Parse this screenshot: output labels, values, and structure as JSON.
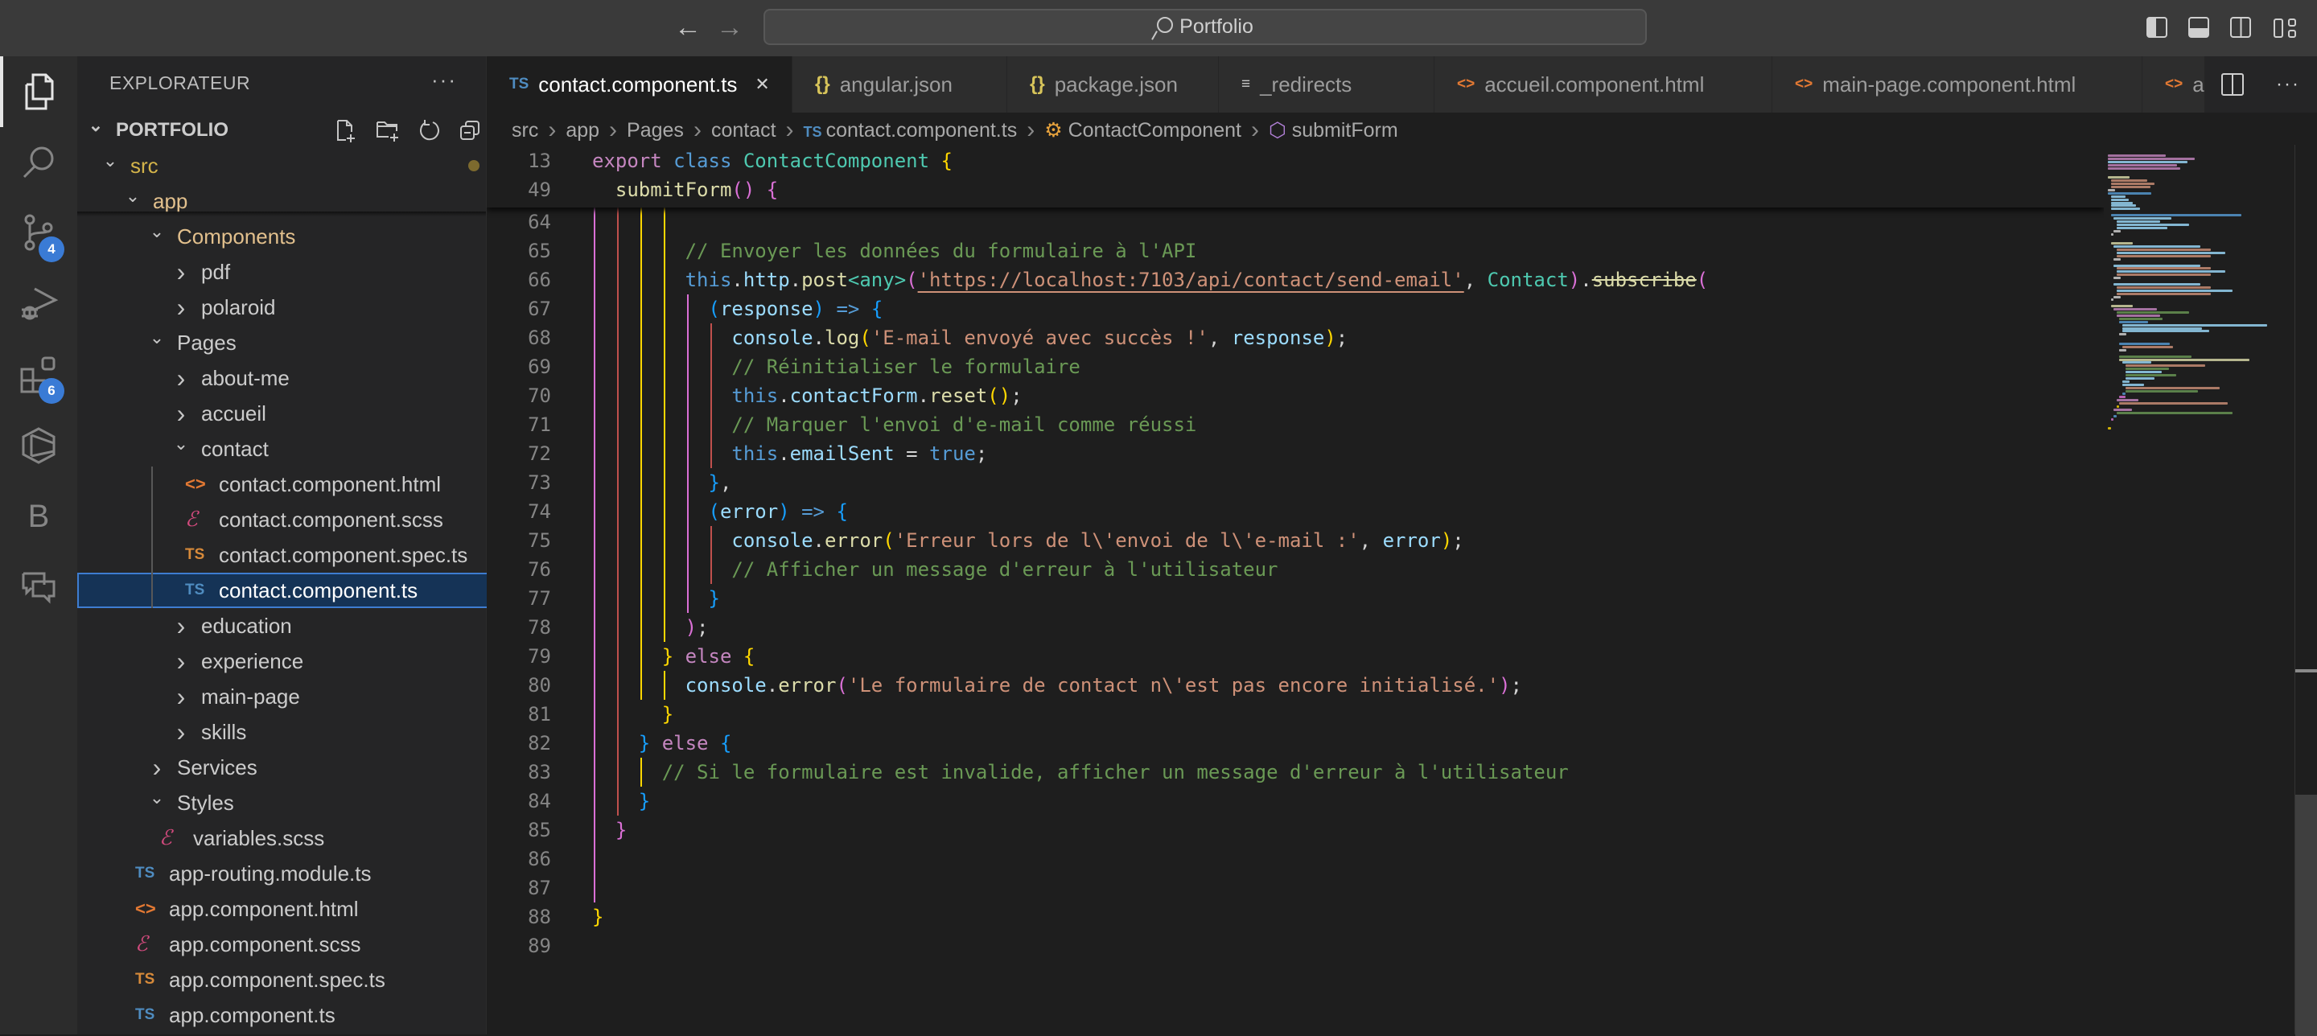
{
  "titlebar": {
    "back_icon": "arrow-left-icon",
    "forward_icon": "arrow-right-icon",
    "search_text": "Portfolio",
    "layout_toggles": [
      "toggle-primary-sidebar-icon",
      "toggle-panel-icon",
      "toggle-secondary-sidebar-icon",
      "customize-layout-icon"
    ]
  },
  "activity_bar": {
    "items": [
      {
        "name": "explorer",
        "icon": "files-icon",
        "active": true
      },
      {
        "name": "search",
        "icon": "search-icon"
      },
      {
        "name": "source-control",
        "icon": "source-control-icon",
        "badge": "4"
      },
      {
        "name": "run-debug",
        "icon": "run-debug-icon"
      },
      {
        "name": "extensions",
        "icon": "extensions-icon",
        "badge": "6"
      },
      {
        "name": "remote-explorer",
        "icon": "hexagon-icon"
      },
      {
        "name": "bootstrap",
        "icon": "b-letter-icon",
        "label": "B"
      },
      {
        "name": "chat",
        "icon": "chat-icon"
      }
    ]
  },
  "sidebar": {
    "title": "EXPLORATEUR",
    "more": "···",
    "root": "PORTFOLIO",
    "tree": [
      {
        "label": "src",
        "type": "folder",
        "open": true,
        "level": 1,
        "git": "modified"
      },
      {
        "label": "app",
        "type": "folder",
        "open": true,
        "level": 2,
        "git": "modified"
      },
      {
        "label": "Components",
        "type": "folder",
        "open": true,
        "level": 3,
        "git": "modified"
      },
      {
        "label": "pdf",
        "type": "folder",
        "open": false,
        "level": 4
      },
      {
        "label": "polaroid",
        "type": "folder",
        "open": false,
        "level": 4
      },
      {
        "label": "Pages",
        "type": "folder",
        "open": true,
        "level": 3
      },
      {
        "label": "about-me",
        "type": "folder",
        "open": false,
        "level": 4
      },
      {
        "label": "accueil",
        "type": "folder",
        "open": false,
        "level": 4
      },
      {
        "label": "contact",
        "type": "folder",
        "open": true,
        "level": 4
      },
      {
        "label": "contact.component.html",
        "type": "html",
        "level": 5
      },
      {
        "label": "contact.component.scss",
        "type": "scss",
        "level": 5
      },
      {
        "label": "contact.component.spec.ts",
        "type": "spec",
        "level": 5
      },
      {
        "label": "contact.component.ts",
        "type": "ts",
        "level": 5,
        "selected": true
      },
      {
        "label": "education",
        "type": "folder",
        "open": false,
        "level": 4
      },
      {
        "label": "experience",
        "type": "folder",
        "open": false,
        "level": 4
      },
      {
        "label": "main-page",
        "type": "folder",
        "open": false,
        "level": 4
      },
      {
        "label": "skills",
        "type": "folder",
        "open": false,
        "level": 4
      },
      {
        "label": "Services",
        "type": "folder",
        "open": false,
        "level": 3
      },
      {
        "label": "Styles",
        "type": "folder",
        "open": true,
        "level": 3
      },
      {
        "label": "variables.scss",
        "type": "scss",
        "level": 4
      },
      {
        "label": "app-routing.module.ts",
        "type": "ts",
        "level": 3
      },
      {
        "label": "app.component.html",
        "type": "html",
        "level": 3
      },
      {
        "label": "app.component.scss",
        "type": "scss",
        "level": 3
      },
      {
        "label": "app.component.spec.ts",
        "type": "spec",
        "level": 3
      },
      {
        "label": "app.component.ts",
        "type": "ts",
        "level": 3
      }
    ],
    "actions": [
      "new-file-icon",
      "new-folder-icon",
      "refresh-icon",
      "collapse-all-icon"
    ]
  },
  "tabs": [
    {
      "label": "contact.component.ts",
      "icon": "TS",
      "kind": "ts",
      "active": true
    },
    {
      "label": "angular.json",
      "icon": "{}",
      "kind": "json"
    },
    {
      "label": "package.json",
      "icon": "{}",
      "kind": "json"
    },
    {
      "label": "_redirects",
      "icon": "≡",
      "kind": "text"
    },
    {
      "label": "accueil.component.html",
      "icon": "<>",
      "kind": "html"
    },
    {
      "label": "main-page.component.html",
      "icon": "<>",
      "kind": "html"
    },
    {
      "label": "abo",
      "icon": "<>",
      "kind": "html"
    }
  ],
  "breadcrumbs": [
    "src",
    "app",
    "Pages",
    "contact",
    "contact.component.ts",
    "ContactComponent",
    "submitForm"
  ],
  "editor": {
    "sticky": [
      {
        "n": "13",
        "tokens": [
          [
            "kw",
            "export "
          ],
          [
            "kb",
            "class "
          ],
          [
            "cls",
            "ContactComponent "
          ],
          [
            "b1",
            "{"
          ]
        ]
      },
      {
        "n": "49",
        "tokens": [
          [
            "pun",
            "  "
          ],
          [
            "fn",
            "submitForm"
          ],
          [
            "b2",
            "()"
          ],
          [
            "pun",
            " "
          ],
          [
            "b2",
            "{"
          ]
        ]
      }
    ],
    "lines": [
      {
        "n": "64",
        "tokens": []
      },
      {
        "n": "65",
        "tokens": [
          [
            "pun",
            "        "
          ],
          [
            "com",
            "// Envoyer les données du formulaire à l'API"
          ]
        ]
      },
      {
        "n": "66",
        "tokens": [
          [
            "pun",
            "        "
          ],
          [
            "kb",
            "this"
          ],
          [
            "pun",
            "."
          ],
          [
            "var",
            "http"
          ],
          [
            "pun",
            "."
          ],
          [
            "fn",
            "post"
          ],
          [
            "cls",
            "<any>"
          ],
          [
            "b2",
            "("
          ],
          [
            "str url",
            "'https://localhost:7103/api/contact/send-email'"
          ],
          [
            "pun",
            ", "
          ],
          [
            "cls",
            "Contact"
          ],
          [
            "b2",
            ")"
          ],
          [
            "pun",
            "."
          ],
          [
            "fn strike",
            "subscribe"
          ],
          [
            "b2",
            "("
          ]
        ]
      },
      {
        "n": "67",
        "tokens": [
          [
            "pun",
            "          "
          ],
          [
            "b3",
            "("
          ],
          [
            "var",
            "response"
          ],
          [
            "b3",
            ")"
          ],
          [
            "pun",
            " "
          ],
          [
            "kb",
            "=>"
          ],
          [
            "pun",
            " "
          ],
          [
            "b3",
            "{"
          ]
        ]
      },
      {
        "n": "68",
        "tokens": [
          [
            "pun",
            "            "
          ],
          [
            "var",
            "console"
          ],
          [
            "pun",
            "."
          ],
          [
            "fn",
            "log"
          ],
          [
            "b1",
            "("
          ],
          [
            "str",
            "'E-mail envoyé avec succès !'"
          ],
          [
            "pun",
            ", "
          ],
          [
            "var",
            "response"
          ],
          [
            "b1",
            ")"
          ],
          [
            "pun",
            ";"
          ]
        ]
      },
      {
        "n": "69",
        "tokens": [
          [
            "pun",
            "            "
          ],
          [
            "com",
            "// Réinitialiser le formulaire"
          ]
        ]
      },
      {
        "n": "70",
        "tokens": [
          [
            "pun",
            "            "
          ],
          [
            "kb",
            "this"
          ],
          [
            "pun",
            "."
          ],
          [
            "var",
            "contactForm"
          ],
          [
            "pun",
            "."
          ],
          [
            "fn",
            "reset"
          ],
          [
            "b1",
            "()"
          ],
          [
            "pun",
            ";"
          ]
        ]
      },
      {
        "n": "71",
        "tokens": [
          [
            "pun",
            "            "
          ],
          [
            "com",
            "// Marquer l'envoi d'e-mail comme réussi"
          ]
        ]
      },
      {
        "n": "72",
        "tokens": [
          [
            "pun",
            "            "
          ],
          [
            "kb",
            "this"
          ],
          [
            "pun",
            "."
          ],
          [
            "var",
            "emailSent"
          ],
          [
            "pun",
            " = "
          ],
          [
            "kb",
            "true"
          ],
          [
            "pun",
            ";"
          ]
        ]
      },
      {
        "n": "73",
        "tokens": [
          [
            "pun",
            "          "
          ],
          [
            "b3",
            "}"
          ],
          [
            "pun",
            ","
          ]
        ]
      },
      {
        "n": "74",
        "tokens": [
          [
            "pun",
            "          "
          ],
          [
            "b3",
            "("
          ],
          [
            "var",
            "error"
          ],
          [
            "b3",
            ")"
          ],
          [
            "pun",
            " "
          ],
          [
            "kb",
            "=>"
          ],
          [
            "pun",
            " "
          ],
          [
            "b3",
            "{"
          ]
        ]
      },
      {
        "n": "75",
        "tokens": [
          [
            "pun",
            "            "
          ],
          [
            "var",
            "console"
          ],
          [
            "pun",
            "."
          ],
          [
            "fn",
            "error"
          ],
          [
            "b1",
            "("
          ],
          [
            "str",
            "'Erreur lors de l\\'envoi de l\\'e-mail :'"
          ],
          [
            "pun",
            ", "
          ],
          [
            "var",
            "error"
          ],
          [
            "b1",
            ")"
          ],
          [
            "pun",
            ";"
          ]
        ]
      },
      {
        "n": "76",
        "tokens": [
          [
            "pun",
            "            "
          ],
          [
            "com",
            "// Afficher un message d'erreur à l'utilisateur"
          ]
        ]
      },
      {
        "n": "77",
        "tokens": [
          [
            "pun",
            "          "
          ],
          [
            "b3",
            "}"
          ]
        ]
      },
      {
        "n": "78",
        "tokens": [
          [
            "pun",
            "        "
          ],
          [
            "b2",
            ")"
          ],
          [
            "pun",
            ";"
          ]
        ]
      },
      {
        "n": "79",
        "tokens": [
          [
            "pun",
            "      "
          ],
          [
            "b1",
            "}"
          ],
          [
            "pun",
            " "
          ],
          [
            "kw",
            "else"
          ],
          [
            "pun",
            " "
          ],
          [
            "b1",
            "{"
          ]
        ]
      },
      {
        "n": "80",
        "tokens": [
          [
            "pun",
            "        "
          ],
          [
            "var",
            "console"
          ],
          [
            "pun",
            "."
          ],
          [
            "fn",
            "error"
          ],
          [
            "b2",
            "("
          ],
          [
            "str",
            "'Le formulaire de contact n\\'est pas encore initialisé.'"
          ],
          [
            "b2",
            ")"
          ],
          [
            "pun",
            ";"
          ]
        ]
      },
      {
        "n": "81",
        "tokens": [
          [
            "pun",
            "      "
          ],
          [
            "b1",
            "}"
          ]
        ]
      },
      {
        "n": "82",
        "tokens": [
          [
            "pun",
            "    "
          ],
          [
            "b3",
            "}"
          ],
          [
            "pun",
            " "
          ],
          [
            "kw",
            "else"
          ],
          [
            "pun",
            " "
          ],
          [
            "b3",
            "{"
          ]
        ]
      },
      {
        "n": "83",
        "tokens": [
          [
            "pun",
            "      "
          ],
          [
            "com",
            "// Si le formulaire est invalide, afficher un message d'erreur à l'utilisateur"
          ]
        ]
      },
      {
        "n": "84",
        "tokens": [
          [
            "pun",
            "    "
          ],
          [
            "b3",
            "}"
          ]
        ]
      },
      {
        "n": "85",
        "tokens": [
          [
            "pun",
            "  "
          ],
          [
            "b2",
            "}"
          ]
        ]
      },
      {
        "n": "86",
        "tokens": []
      },
      {
        "n": "87",
        "tokens": []
      },
      {
        "n": "88",
        "tokens": [
          [
            "b1",
            "}"
          ]
        ]
      },
      {
        "n": "89",
        "tokens": []
      }
    ]
  },
  "colors": {
    "accent": "#3a7bd5",
    "selection": "#153356",
    "git_modified_dot": "#7a6a3a"
  }
}
